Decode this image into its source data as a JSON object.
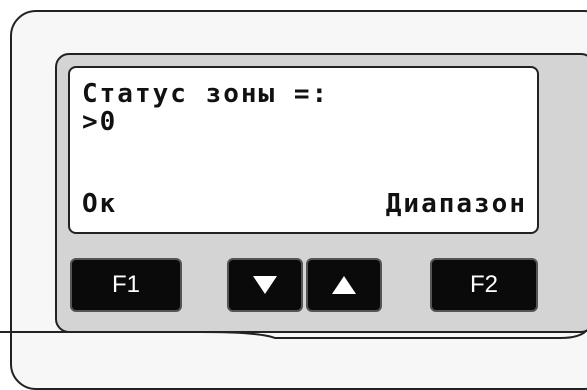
{
  "lcd": {
    "line1": "Статус зоны =:",
    "line2": ">0",
    "softkey_left": "Ок",
    "softkey_right": "Диапазон"
  },
  "keys": {
    "f1": "F1",
    "f2": "F2",
    "down_icon": "triangle-down-icon",
    "up_icon": "triangle-up-icon"
  },
  "colors": {
    "panel": "#d4d4d4",
    "key": "#0a0a0a",
    "screen": "#ffffff"
  }
}
